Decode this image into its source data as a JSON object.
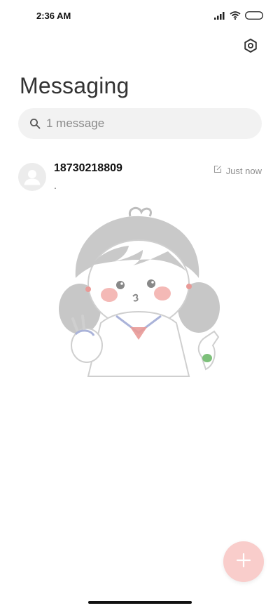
{
  "status_bar": {
    "time": "2:36 AM",
    "icons": [
      "cellular-signal-icon",
      "wifi-icon",
      "battery-icon"
    ]
  },
  "header": {
    "title": "Messaging",
    "settings_icon": "settings-hex-icon"
  },
  "search": {
    "text": "1 message",
    "icon": "search-icon"
  },
  "conversations": [
    {
      "sender": "18730218809",
      "preview": ".",
      "time": "Just now",
      "draft_icon": "edit-draft-icon"
    }
  ],
  "fab": {
    "icon": "plus-icon",
    "color": "#f9cdcb"
  },
  "colors": {
    "background": "#ffffff",
    "search_bg": "#f2f2f2",
    "accent": "#f48c88"
  }
}
